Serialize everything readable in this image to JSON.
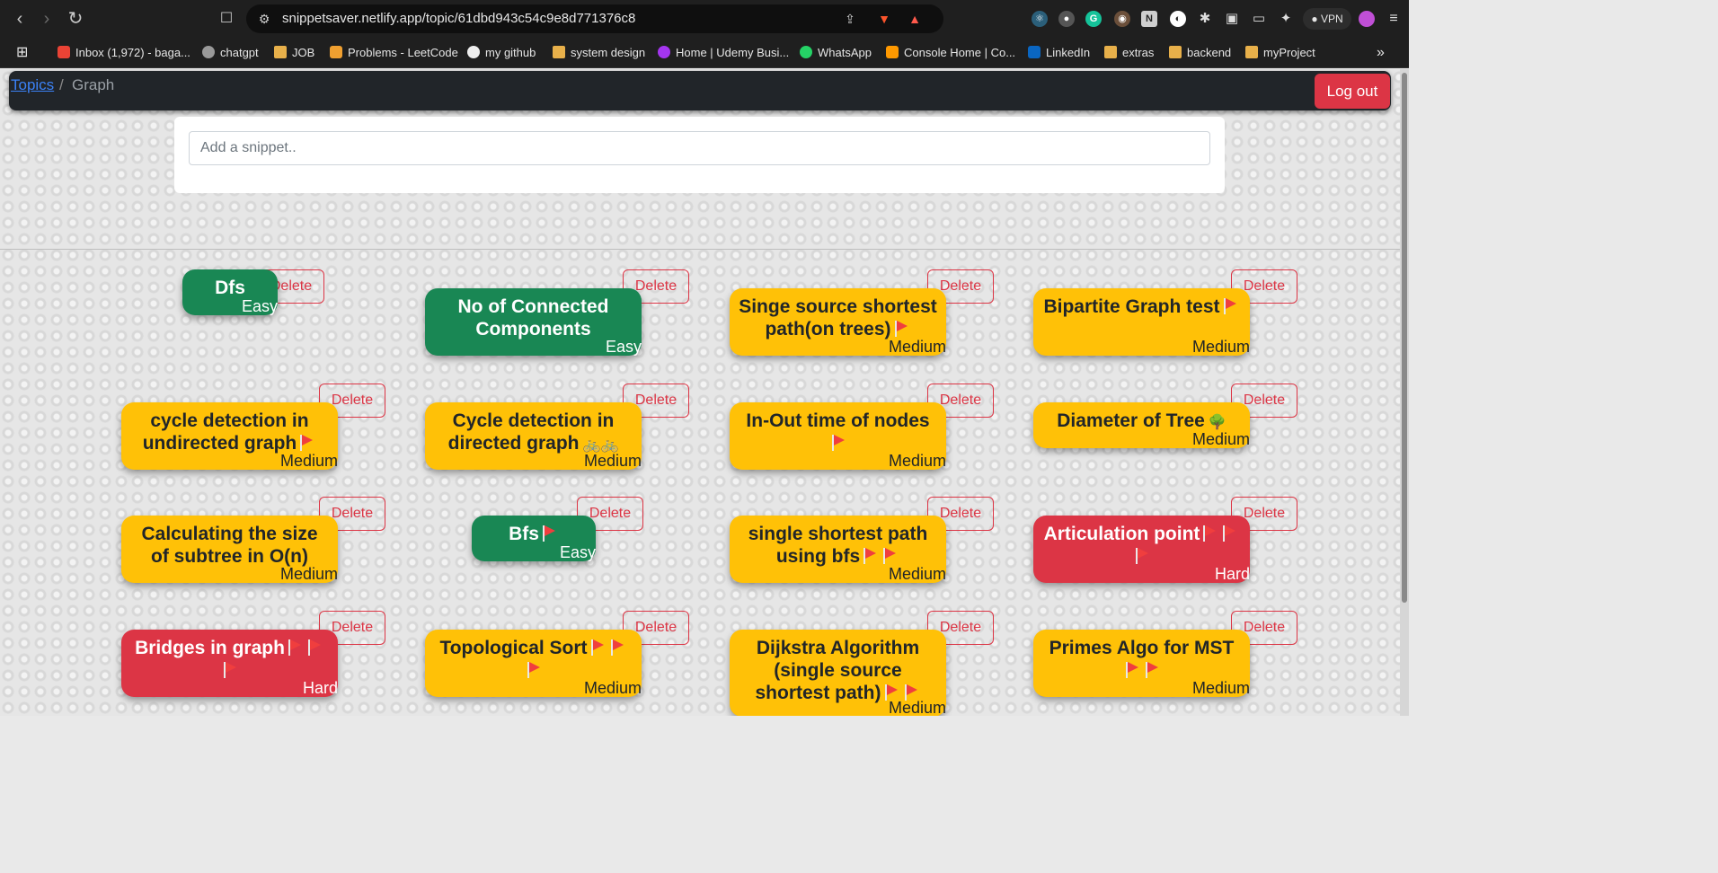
{
  "browser": {
    "url": "snippetsaver.netlify.app/topic/61dbd943c54c9e8d771376c8",
    "vpn_label": "VPN",
    "bookmarks": [
      {
        "label": "Inbox (1,972) - baga...",
        "icon": "gmail-icon"
      },
      {
        "label": "chatgpt",
        "icon": "chatgpt-icon"
      },
      {
        "label": "JOB",
        "icon": "folder-icon"
      },
      {
        "label": "Problems - LeetCode",
        "icon": "leetcode-icon"
      },
      {
        "label": "my github",
        "icon": "github-icon"
      },
      {
        "label": "system design",
        "icon": "folder-icon"
      },
      {
        "label": "Home | Udemy Busi...",
        "icon": "udemy-icon"
      },
      {
        "label": "WhatsApp",
        "icon": "whatsapp-icon"
      },
      {
        "label": "Console Home | Co...",
        "icon": "aws-icon"
      },
      {
        "label": "LinkedIn",
        "icon": "linkedin-icon"
      },
      {
        "label": "extras",
        "icon": "folder-icon"
      },
      {
        "label": "backend",
        "icon": "folder-icon"
      },
      {
        "label": "myProject",
        "icon": "folder-icon"
      }
    ]
  },
  "navbar": {
    "breadcrumb_root": "Topics",
    "breadcrumb_separator": "/",
    "breadcrumb_current": "Graph",
    "logout_label": "Log out"
  },
  "snippet_input": {
    "placeholder": "Add a snippet.."
  },
  "delete_label": "Delete",
  "snippets": [
    {
      "title": "Dfs",
      "difficulty": "Easy",
      "flags": 0
    },
    {
      "title": "No of Connected Components",
      "difficulty": "Easy",
      "flags": 0
    },
    {
      "title": "Singe source shortest path(on trees)",
      "difficulty": "Medium",
      "flags": 1
    },
    {
      "title": "Bipartite Graph test",
      "difficulty": "Medium",
      "flags": 1
    },
    {
      "title": "cycle detection in undirected graph",
      "difficulty": "Medium",
      "flags": 1
    },
    {
      "title": "Cycle detection in directed graph",
      "difficulty": "Medium",
      "flags": 0,
      "emoji": "🚲🚲"
    },
    {
      "title": "In-Out time of nodes",
      "difficulty": "Medium",
      "flags": 1
    },
    {
      "title": "Diameter of Tree",
      "difficulty": "Medium",
      "flags": 0,
      "emoji": "🌳"
    },
    {
      "title": "Calculating the size of subtree in O(n)",
      "difficulty": "Medium",
      "flags": 0
    },
    {
      "title": "Bfs",
      "difficulty": "Easy",
      "flags": 1
    },
    {
      "title": "single shortest path using bfs",
      "difficulty": "Medium",
      "flags": 2
    },
    {
      "title": "Articulation point",
      "difficulty": "Hard",
      "flags": 3
    },
    {
      "title": "Bridges in graph",
      "difficulty": "Hard",
      "flags": 3
    },
    {
      "title": "Topological Sort",
      "difficulty": "Medium",
      "flags": 3
    },
    {
      "title": "Dijkstra Algorithm (single source shortest path)",
      "difficulty": "Medium",
      "flags": 2
    },
    {
      "title": "Primes Algo for MST",
      "difficulty": "Medium",
      "flags": 2
    }
  ]
}
